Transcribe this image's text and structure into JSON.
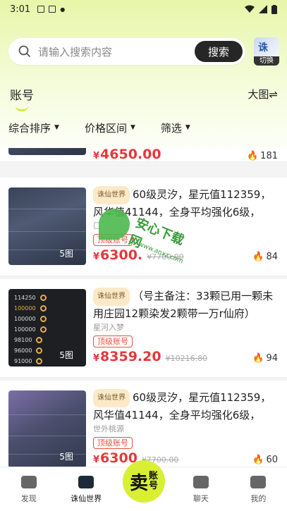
{
  "status_bar": {
    "time": "3:01"
  },
  "search": {
    "placeholder": "请输入搜索内容",
    "button_label": "搜索",
    "switch_label": "切换"
  },
  "tabs": {
    "title": "账号",
    "view_toggle": "大图⇌"
  },
  "filters": {
    "sort": "综合排序",
    "price_range": "价格区间",
    "screen": "筛选"
  },
  "cards": [
    {
      "price": "4650.00",
      "heat": "181",
      "image_count": ""
    },
    {
      "tag": "诛仙世界",
      "description": "60级灵汐，星元值112359，风华值41144，全身平均强化6级，筑...",
      "seller": "匚",
      "badge": "顶级账号",
      "price": "6300.",
      "original_price": "¥7700.00",
      "heat": "84",
      "image_count": "5图"
    },
    {
      "tag": "诛仙世界",
      "description": "（号主备注：33颗已用一颗未用庄园12颗染发2颗带一万r仙府）60...",
      "seller": "星河入梦",
      "badge": "顶级账号",
      "price": "8359.20",
      "original_price": "¥10216.80",
      "heat": "94",
      "image_count": "5图",
      "thumb_rows": [
        "114250",
        "100000",
        "100000",
        "100000",
        "98100",
        "96000",
        "91000"
      ]
    },
    {
      "tag": "诛仙世界",
      "description": "60级灵汐，星元值112359，风华值41144，全身平均强化6级，筑...",
      "seller": "世外桃源",
      "badge": "顶级账号",
      "price": "6300",
      "original_price": "¥7700.00",
      "heat": "60",
      "image_count": "5图"
    }
  ],
  "watermark": {
    "text": "安心下载网",
    "url": "www.anxz.com"
  },
  "bottom_nav": {
    "discover": "发现",
    "zhuxian": "诛仙世界",
    "sell_big": "卖",
    "sell_small_1": "账",
    "sell_small_2": "号",
    "chat": "聊天",
    "mine": "我的"
  },
  "colors": {
    "accent": "#d8ef33",
    "price": "#e5383b",
    "badge": "#e5513c"
  }
}
